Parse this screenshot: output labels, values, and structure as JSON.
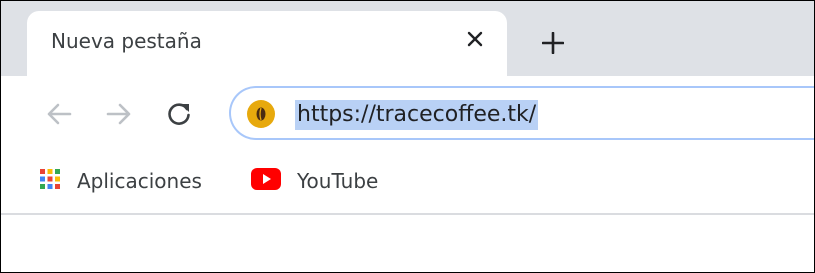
{
  "tab": {
    "title": "Nueva pestaña",
    "close_icon": "close-icon",
    "new_tab_icon": "plus-icon"
  },
  "toolbar": {
    "back_icon": "arrow-left-icon",
    "forward_icon": "arrow-right-icon",
    "reload_icon": "reload-icon",
    "url": "https://tracecoffee.tk/",
    "site_icon": "coffee-bean-icon"
  },
  "bookmarks": [
    {
      "label": "Aplicaciones",
      "icon": "apps-grid-icon"
    },
    {
      "label": "YouTube",
      "icon": "youtube-icon"
    }
  ],
  "colors": {
    "tabstrip_bg": "#dee1e6",
    "url_highlight": "#b9d1f5",
    "omnibox_focus": "#a8c7fa",
    "youtube_red": "#ff0000",
    "site_icon_bg": "#e7a90d"
  }
}
